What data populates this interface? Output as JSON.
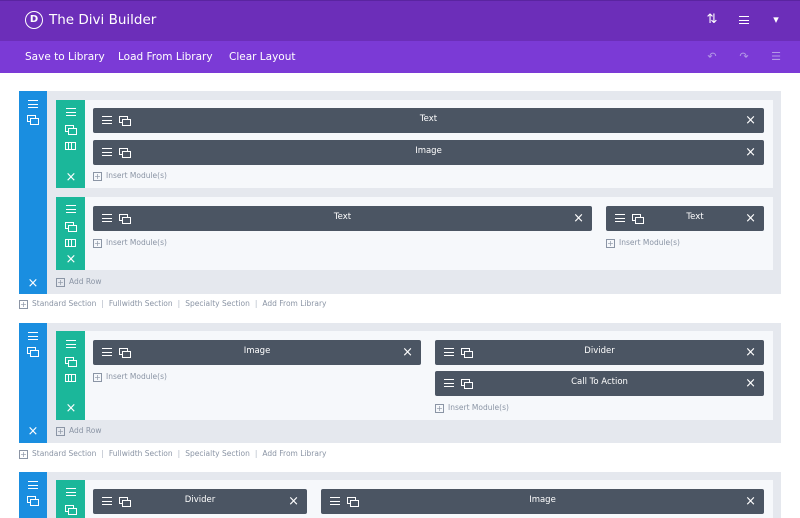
{
  "header": {
    "logo_letter": "D",
    "title": "The Divi Builder",
    "icons": [
      "sort-icon",
      "menu-icon",
      "chevron-down-icon"
    ]
  },
  "toolbar": {
    "save_label": "Save to Library",
    "load_label": "Load From Library",
    "clear_label": "Clear Layout",
    "icons": [
      "undo-icon",
      "redo-icon",
      "history-icon"
    ]
  },
  "common": {
    "insert_modules": "Insert Module(s)",
    "add_row": "Add Row",
    "standard_section": "Standard Section",
    "fullwidth_section": "Fullwidth Section",
    "specialty_section": "Specialty Section",
    "add_from_library": "Add From Library",
    "separator": "|",
    "plus": "+",
    "close": "×"
  },
  "sections": [
    {
      "rows": [
        {
          "columns": [
            {
              "modules": [
                "Text",
                "Image"
              ]
            }
          ]
        },
        {
          "columns": [
            {
              "modules": [
                "Text"
              ]
            },
            {
              "modules": [
                "Text"
              ]
            }
          ]
        }
      ]
    },
    {
      "rows": [
        {
          "columns": [
            {
              "modules": [
                "Image"
              ]
            },
            {
              "modules": [
                "Divider",
                "Call To Action"
              ]
            }
          ]
        }
      ]
    },
    {
      "rows": [
        {
          "columns": [
            {
              "modules": [
                "Divider"
              ]
            },
            {
              "modules": [
                "Image"
              ]
            }
          ]
        }
      ]
    }
  ],
  "colors": {
    "header_bg": "#6c2eb9",
    "toolbar_bg": "#7b3ad6",
    "section_bar": "#1a8ee0",
    "row_bar": "#1bb79a",
    "module_bg": "#4b5563",
    "section_bg": "#e5e8ee",
    "row_bg": "#f6f8fb"
  }
}
